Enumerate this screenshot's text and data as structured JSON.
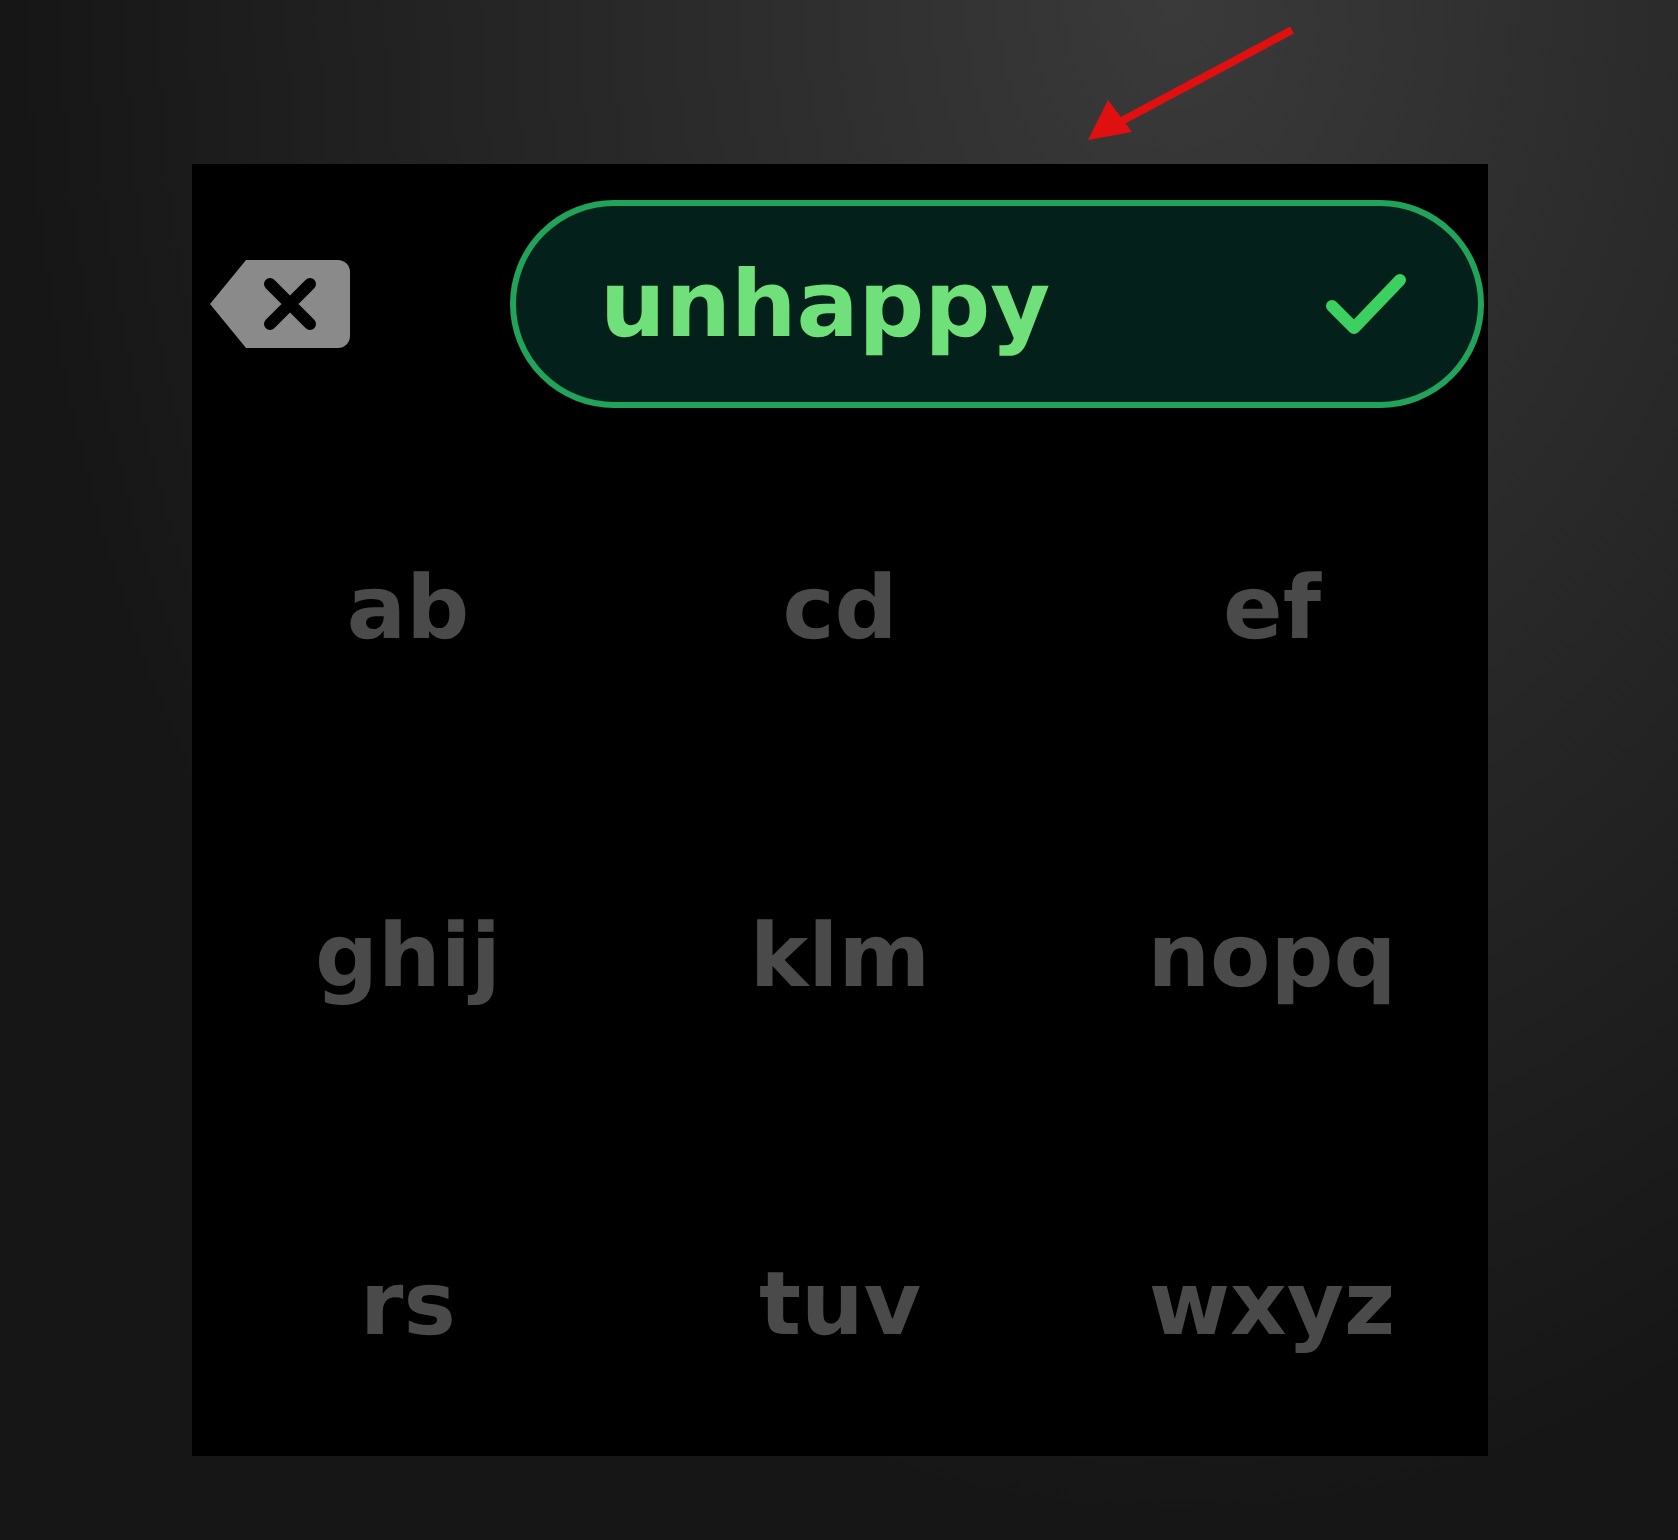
{
  "input": {
    "value": "unhappy",
    "confirmed": true
  },
  "keys": [
    {
      "label": "ab"
    },
    {
      "label": "cd"
    },
    {
      "label": "ef"
    },
    {
      "label": "ghij"
    },
    {
      "label": "klm"
    },
    {
      "label": "nopq"
    },
    {
      "label": "rs"
    },
    {
      "label": "tuv"
    },
    {
      "label": "wxyz"
    }
  ]
}
